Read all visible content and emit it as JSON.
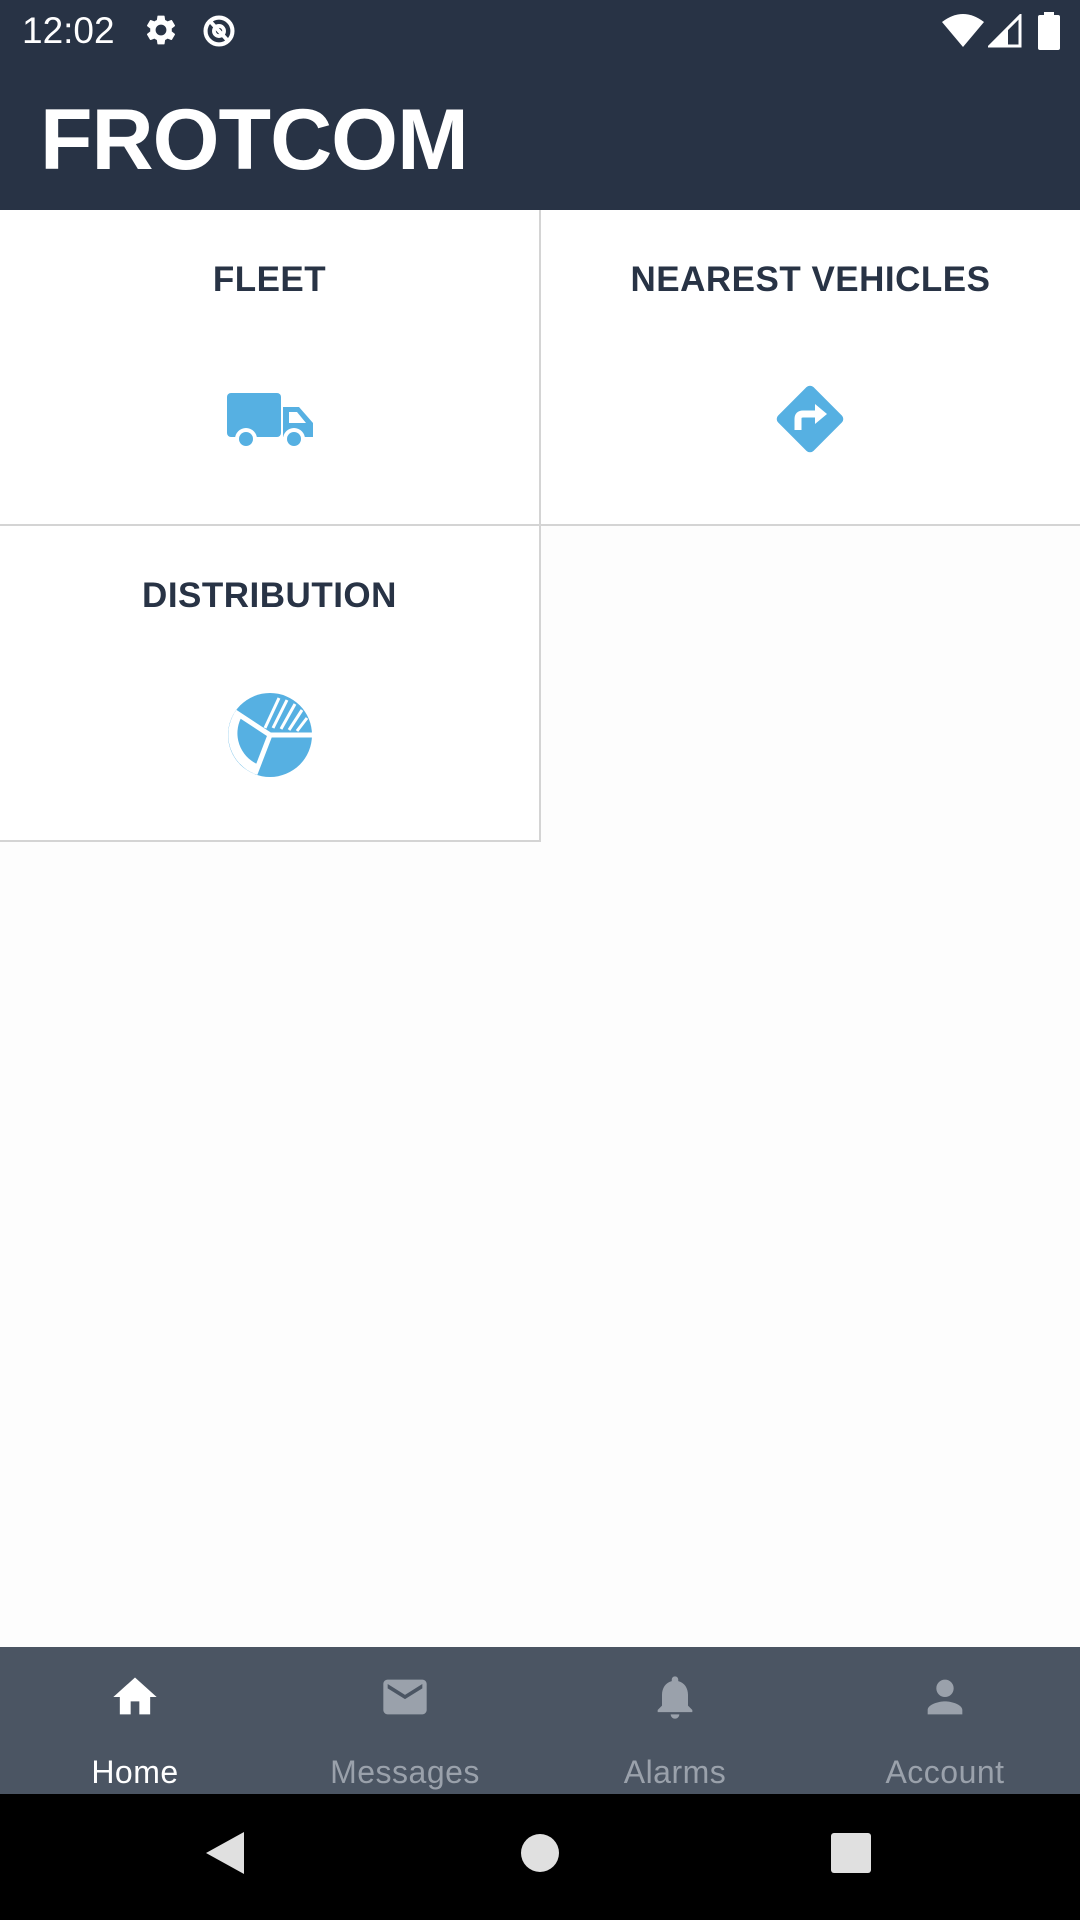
{
  "status_bar": {
    "time": "12:02",
    "left_icons": [
      "settings-gear-icon",
      "data-saver-icon"
    ],
    "right_icons": [
      "wifi-icon",
      "cell-signal-icon",
      "battery-icon"
    ]
  },
  "header": {
    "logo": "FROTCOM"
  },
  "tiles": [
    {
      "label": "FLEET",
      "icon": "truck-icon"
    },
    {
      "label": "NEAREST VEHICLES",
      "icon": "direction-sign-icon"
    },
    {
      "label": "DISTRIBUTION",
      "icon": "pie-chart-icon"
    }
  ],
  "bottom_nav": {
    "items": [
      {
        "label": "Home",
        "icon": "home-icon",
        "active": true
      },
      {
        "label": "Messages",
        "icon": "envelope-icon",
        "active": false
      },
      {
        "label": "Alarms",
        "icon": "bell-icon",
        "active": false
      },
      {
        "label": "Account",
        "icon": "person-icon",
        "active": false
      }
    ]
  },
  "system_nav": {
    "buttons": [
      "back-icon",
      "home-circle-icon",
      "recents-icon"
    ]
  },
  "colors": {
    "header_bg": "#283345",
    "accent": "#56b0e2",
    "bottom_nav_bg": "#4b5563",
    "nav_inactive": "#9aa1ab",
    "tile_border": "#d4d4d4"
  }
}
